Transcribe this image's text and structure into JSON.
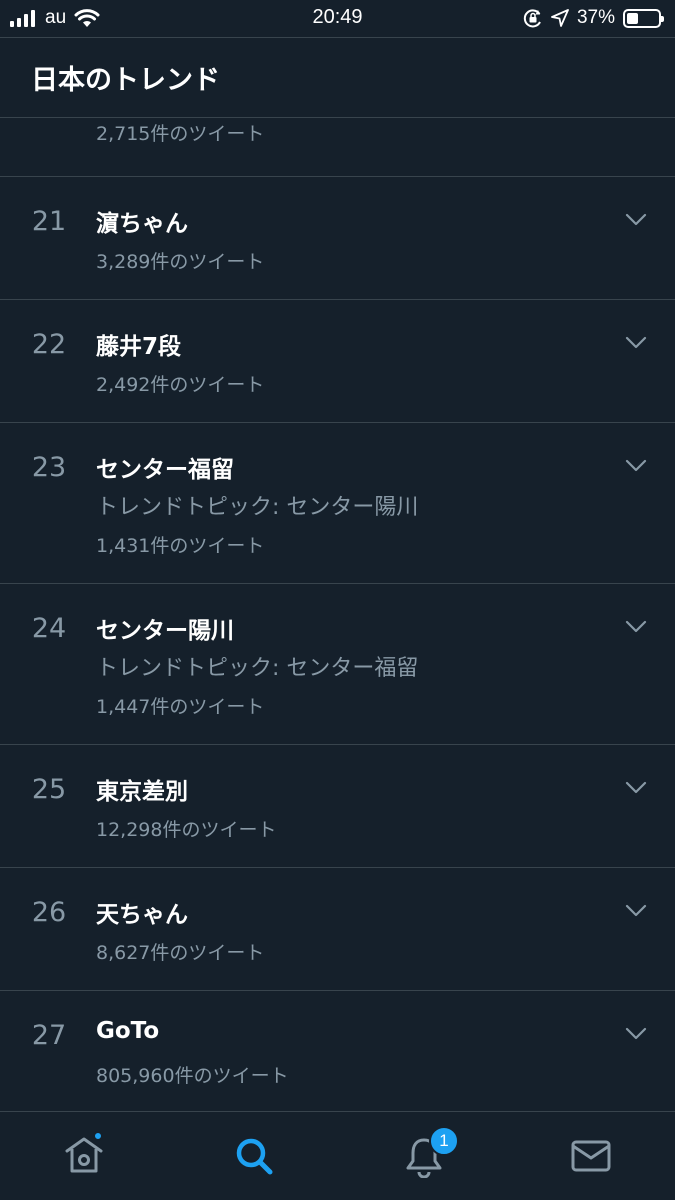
{
  "status_bar": {
    "carrier": "au",
    "time": "20:49",
    "battery_percent": "37%",
    "battery_level": 0.37
  },
  "header": {
    "title": "日本のトレンド"
  },
  "partial_row": {
    "count": "2,715件のツイート"
  },
  "trends": [
    {
      "rank": "21",
      "name": "濵ちゃん",
      "count": "3,289件のツイート"
    },
    {
      "rank": "22",
      "name": "藤井7段",
      "count": "2,492件のツイート"
    },
    {
      "rank": "23",
      "name": "センター福留",
      "topic": "トレンドトピック: センター陽川",
      "count": "1,431件のツイート"
    },
    {
      "rank": "24",
      "name": "センター陽川",
      "topic": "トレンドトピック: センター福留",
      "count": "1,447件のツイート"
    },
    {
      "rank": "25",
      "name": "東京差別",
      "count": "12,298件のツイート"
    },
    {
      "rank": "26",
      "name": "天ちゃん",
      "count": "8,627件のツイート"
    },
    {
      "rank": "27",
      "name": "GoTo",
      "count": "805,960件のツイート"
    }
  ],
  "tab_bar": {
    "notifications_badge": "1",
    "active_tab": "search",
    "accent_color": "#1da1f2"
  }
}
